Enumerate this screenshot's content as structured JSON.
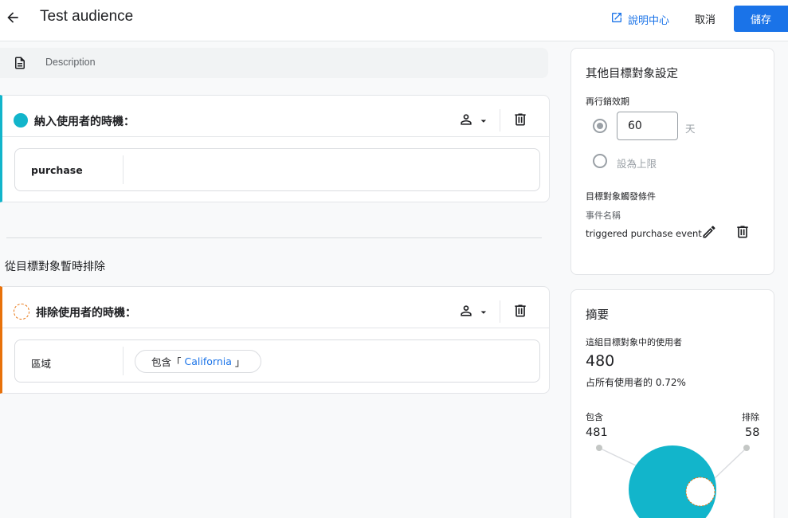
{
  "header": {
    "title": "Test audience",
    "help_label": "說明中心",
    "cancel_label": "取消",
    "save_label": "儲存"
  },
  "description": {
    "placeholder": "Description"
  },
  "include_card": {
    "title": "納入使用者的時機：",
    "condition_label": "purchase"
  },
  "exclude_section": {
    "heading": "從目標對象暫時排除"
  },
  "exclude_card": {
    "title": "排除使用者的時機：",
    "condition_label": "區域",
    "chip_prefix": "包含「",
    "chip_value": "California",
    "chip_suffix": "」"
  },
  "settings_panel": {
    "title": "其他目標對象設定",
    "membership_label": "再行銷效期",
    "duration_value": "60",
    "duration_unit": "天",
    "max_option_label": "設為上限",
    "trigger_heading": "目標對象觸發條件",
    "event_name_label": "事件名稱",
    "event_name_value": "triggered purchase event"
  },
  "summary_panel": {
    "title": "摘要",
    "users_label": "這組目標對象中的使用者",
    "users_count": "480",
    "percent_text": "占所有使用者的 0.72%",
    "include_label": "包含",
    "include_count": "481",
    "exclude_label": "排除",
    "exclude_count": "58"
  },
  "colors": {
    "accent": "#1a73e8",
    "include": "#12b5cb",
    "exclude": "#e8710a"
  },
  "icons": [
    "arrow-back-icon",
    "open-in-new-icon",
    "document-icon",
    "person-icon",
    "dropdown-arrow-icon",
    "trash-icon",
    "pencil-icon"
  ]
}
